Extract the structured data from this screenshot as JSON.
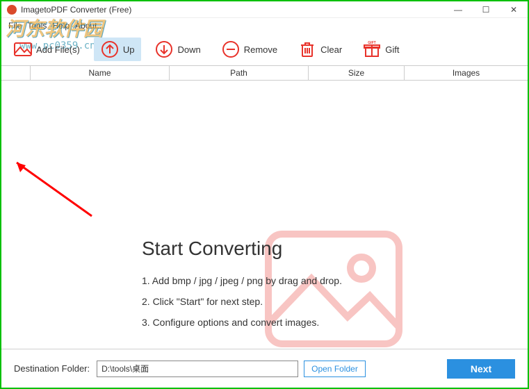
{
  "window": {
    "title": "ImagetoPDF Converter (Free)"
  },
  "menu": {
    "file": "File",
    "tools": "Tools",
    "help": "Help",
    "about": "About..."
  },
  "toolbar": {
    "add": "Add File(s)",
    "up": "Up",
    "down": "Down",
    "remove": "Remove",
    "clear": "Clear",
    "gift": "Gift"
  },
  "columns": {
    "name": "Name",
    "path": "Path",
    "size": "Size",
    "images": "Images"
  },
  "cta": {
    "title": "Start Converting",
    "step1": "1. Add bmp / jpg / jpeg / png by drag and drop.",
    "step2": "2. Click \"Start\" for next step.",
    "step3": "3. Configure options and convert images."
  },
  "footer": {
    "label": "Destination Folder:",
    "path": "D:\\tools\\桌面",
    "open": "Open Folder",
    "next": "Next"
  },
  "watermark": {
    "line1": "河东软件园",
    "line2": "www.pc0359.cn"
  },
  "colors": {
    "accent": "#2b90e0",
    "red": "#e8322a"
  }
}
